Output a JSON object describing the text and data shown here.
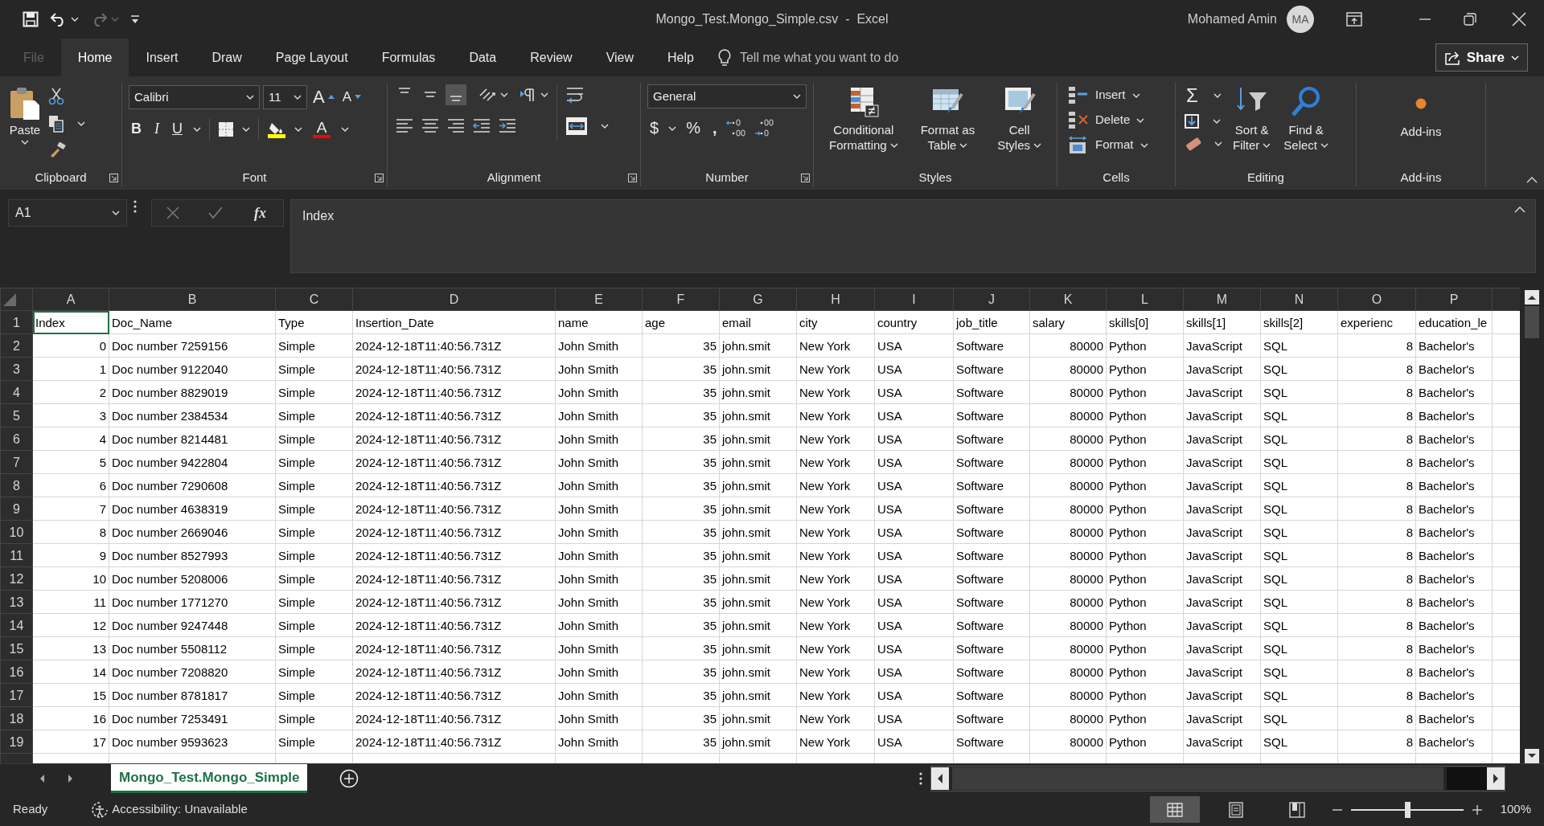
{
  "title_bar": {
    "title": "Mongo_Test.Mongo_Simple.csv  -  Excel",
    "user_name": "Mohamed Amin",
    "user_initials": "MA"
  },
  "quick_access": {
    "redo": {
      "disabled": true
    }
  },
  "menu_tabs": [
    {
      "label": "File",
      "selected": false
    },
    {
      "label": "Home",
      "selected": true
    },
    {
      "label": "Insert",
      "selected": false
    },
    {
      "label": "Draw",
      "selected": false
    },
    {
      "label": "Page Layout",
      "selected": false
    },
    {
      "label": "Formulas",
      "selected": false
    },
    {
      "label": "Data",
      "selected": false
    },
    {
      "label": "Review",
      "selected": false
    },
    {
      "label": "View",
      "selected": false
    },
    {
      "label": "Help",
      "selected": false
    }
  ],
  "tell_me": {
    "placeholder": "Tell me what you want to do"
  },
  "share": {
    "label": "Share"
  },
  "ribbon": {
    "clipboard": {
      "paste": "Paste",
      "title": "Clipboard"
    },
    "font": {
      "font_name": "Calibri",
      "font_size": "11",
      "grow": "A",
      "shrink": "A",
      "bold": "B",
      "italic": "I",
      "underline": "U",
      "font_color": "A",
      "title": "Font"
    },
    "alignment": {
      "vertical": [
        {
          "selected": false
        },
        {
          "selected": false
        },
        {
          "selected": true
        }
      ],
      "horizontal": [
        {
          "selected": false
        },
        {
          "selected": false
        },
        {
          "selected": false
        }
      ],
      "title": "Alignment"
    },
    "number": {
      "format": "General",
      "currency": "$",
      "percent": "%",
      "comma": ",",
      "title": "Number"
    },
    "styles": {
      "buttons": [
        {
          "lines": [
            "Conditional",
            "Formatting"
          ]
        },
        {
          "lines": [
            "Format as",
            "Table"
          ]
        },
        {
          "lines": [
            "Cell",
            "Styles"
          ]
        }
      ],
      "title": "Styles"
    },
    "cells": {
      "buttons": [
        "Insert",
        "Delete",
        "Format"
      ],
      "title": "Cells"
    },
    "editing": {
      "autosum": "Σ",
      "buttons": [
        {
          "lines": [
            "Sort &",
            "Filter"
          ]
        },
        {
          "lines": [
            "Find &",
            "Select"
          ]
        }
      ],
      "title": "Editing"
    },
    "add_ins": {
      "button": "Add-ins",
      "title": "Add-ins"
    }
  },
  "formula_bar": {
    "name_box": "A1",
    "function_label": "fx",
    "formula": "Index"
  },
  "sheet": {
    "columns": [
      "A",
      "B",
      "C",
      "D",
      "E",
      "F",
      "G",
      "H",
      "I",
      "J",
      "K",
      "L",
      "M",
      "N",
      "O",
      "P"
    ],
    "rows": [
      {
        "number": "1",
        "cells": [
          "Index",
          "Doc_Name",
          "Type",
          "Insertion_Date",
          "name",
          "age",
          "email",
          "city",
          "country",
          "job_title",
          "salary",
          "skills[0]",
          "skills[1]",
          "skills[2]",
          "experienc",
          "education_le"
        ]
      },
      {
        "number": "2",
        "cells": [
          "0",
          "Doc number 7259156",
          "Simple",
          "2024-12-18T11:40:56.731Z",
          "John Smith",
          "35",
          "john.smit",
          "New York",
          "USA",
          "Software",
          "80000",
          "Python",
          "JavaScript",
          "SQL",
          "8",
          "Bachelor's"
        ]
      },
      {
        "number": "3",
        "cells": [
          "1",
          "Doc number 9122040",
          "Simple",
          "2024-12-18T11:40:56.731Z",
          "John Smith",
          "35",
          "john.smit",
          "New York",
          "USA",
          "Software",
          "80000",
          "Python",
          "JavaScript",
          "SQL",
          "8",
          "Bachelor's"
        ]
      },
      {
        "number": "4",
        "cells": [
          "2",
          "Doc number 8829019",
          "Simple",
          "2024-12-18T11:40:56.731Z",
          "John Smith",
          "35",
          "john.smit",
          "New York",
          "USA",
          "Software",
          "80000",
          "Python",
          "JavaScript",
          "SQL",
          "8",
          "Bachelor's"
        ]
      },
      {
        "number": "5",
        "cells": [
          "3",
          "Doc number 2384534",
          "Simple",
          "2024-12-18T11:40:56.731Z",
          "John Smith",
          "35",
          "john.smit",
          "New York",
          "USA",
          "Software",
          "80000",
          "Python",
          "JavaScript",
          "SQL",
          "8",
          "Bachelor's"
        ]
      },
      {
        "number": "6",
        "cells": [
          "4",
          "Doc number 8214481",
          "Simple",
          "2024-12-18T11:40:56.731Z",
          "John Smith",
          "35",
          "john.smit",
          "New York",
          "USA",
          "Software",
          "80000",
          "Python",
          "JavaScript",
          "SQL",
          "8",
          "Bachelor's"
        ]
      },
      {
        "number": "7",
        "cells": [
          "5",
          "Doc number 9422804",
          "Simple",
          "2024-12-18T11:40:56.731Z",
          "John Smith",
          "35",
          "john.smit",
          "New York",
          "USA",
          "Software",
          "80000",
          "Python",
          "JavaScript",
          "SQL",
          "8",
          "Bachelor's"
        ]
      },
      {
        "number": "8",
        "cells": [
          "6",
          "Doc number 7290608",
          "Simple",
          "2024-12-18T11:40:56.731Z",
          "John Smith",
          "35",
          "john.smit",
          "New York",
          "USA",
          "Software",
          "80000",
          "Python",
          "JavaScript",
          "SQL",
          "8",
          "Bachelor's"
        ]
      },
      {
        "number": "9",
        "cells": [
          "7",
          "Doc number 4638319",
          "Simple",
          "2024-12-18T11:40:56.731Z",
          "John Smith",
          "35",
          "john.smit",
          "New York",
          "USA",
          "Software",
          "80000",
          "Python",
          "JavaScript",
          "SQL",
          "8",
          "Bachelor's"
        ]
      },
      {
        "number": "10",
        "cells": [
          "8",
          "Doc number 2669046",
          "Simple",
          "2024-12-18T11:40:56.731Z",
          "John Smith",
          "35",
          "john.smit",
          "New York",
          "USA",
          "Software",
          "80000",
          "Python",
          "JavaScript",
          "SQL",
          "8",
          "Bachelor's"
        ]
      },
      {
        "number": "11",
        "cells": [
          "9",
          "Doc number 8527993",
          "Simple",
          "2024-12-18T11:40:56.731Z",
          "John Smith",
          "35",
          "john.smit",
          "New York",
          "USA",
          "Software",
          "80000",
          "Python",
          "JavaScript",
          "SQL",
          "8",
          "Bachelor's"
        ]
      },
      {
        "number": "12",
        "cells": [
          "10",
          "Doc number 5208006",
          "Simple",
          "2024-12-18T11:40:56.731Z",
          "John Smith",
          "35",
          "john.smit",
          "New York",
          "USA",
          "Software",
          "80000",
          "Python",
          "JavaScript",
          "SQL",
          "8",
          "Bachelor's"
        ]
      },
      {
        "number": "13",
        "cells": [
          "11",
          "Doc number 1771270",
          "Simple",
          "2024-12-18T11:40:56.731Z",
          "John Smith",
          "35",
          "john.smit",
          "New York",
          "USA",
          "Software",
          "80000",
          "Python",
          "JavaScript",
          "SQL",
          "8",
          "Bachelor's"
        ]
      },
      {
        "number": "14",
        "cells": [
          "12",
          "Doc number 9247448",
          "Simple",
          "2024-12-18T11:40:56.731Z",
          "John Smith",
          "35",
          "john.smit",
          "New York",
          "USA",
          "Software",
          "80000",
          "Python",
          "JavaScript",
          "SQL",
          "8",
          "Bachelor's"
        ]
      },
      {
        "number": "15",
        "cells": [
          "13",
          "Doc number 5508112",
          "Simple",
          "2024-12-18T11:40:56.731Z",
          "John Smith",
          "35",
          "john.smit",
          "New York",
          "USA",
          "Software",
          "80000",
          "Python",
          "JavaScript",
          "SQL",
          "8",
          "Bachelor's"
        ]
      },
      {
        "number": "16",
        "cells": [
          "14",
          "Doc number 7208820",
          "Simple",
          "2024-12-18T11:40:56.731Z",
          "John Smith",
          "35",
          "john.smit",
          "New York",
          "USA",
          "Software",
          "80000",
          "Python",
          "JavaScript",
          "SQL",
          "8",
          "Bachelor's"
        ]
      },
      {
        "number": "17",
        "cells": [
          "15",
          "Doc number 8781817",
          "Simple",
          "2024-12-18T11:40:56.731Z",
          "John Smith",
          "35",
          "john.smit",
          "New York",
          "USA",
          "Software",
          "80000",
          "Python",
          "JavaScript",
          "SQL",
          "8",
          "Bachelor's"
        ]
      },
      {
        "number": "18",
        "cells": [
          "16",
          "Doc number 7253491",
          "Simple",
          "2024-12-18T11:40:56.731Z",
          "John Smith",
          "35",
          "john.smit",
          "New York",
          "USA",
          "Software",
          "80000",
          "Python",
          "JavaScript",
          "SQL",
          "8",
          "Bachelor's"
        ]
      },
      {
        "number": "19",
        "cells": [
          "17",
          "Doc number 9593623",
          "Simple",
          "2024-12-18T11:40:56.731Z",
          "John Smith",
          "35",
          "john.smit",
          "New York",
          "USA",
          "Software",
          "80000",
          "Python",
          "JavaScript",
          "SQL",
          "8",
          "Bachelor's"
        ]
      }
    ]
  },
  "sheet_tabs": [
    {
      "label": "Mongo_Test.Mongo_Simple",
      "selected": true
    }
  ],
  "status_bar": {
    "status": "Ready",
    "accessibility": "Accessibility: Unavailable",
    "views": [
      {
        "selected": true
      },
      {
        "selected": false
      },
      {
        "selected": false
      }
    ],
    "zoom": {
      "level": 0.5
    },
    "zoom_label": "100%"
  }
}
